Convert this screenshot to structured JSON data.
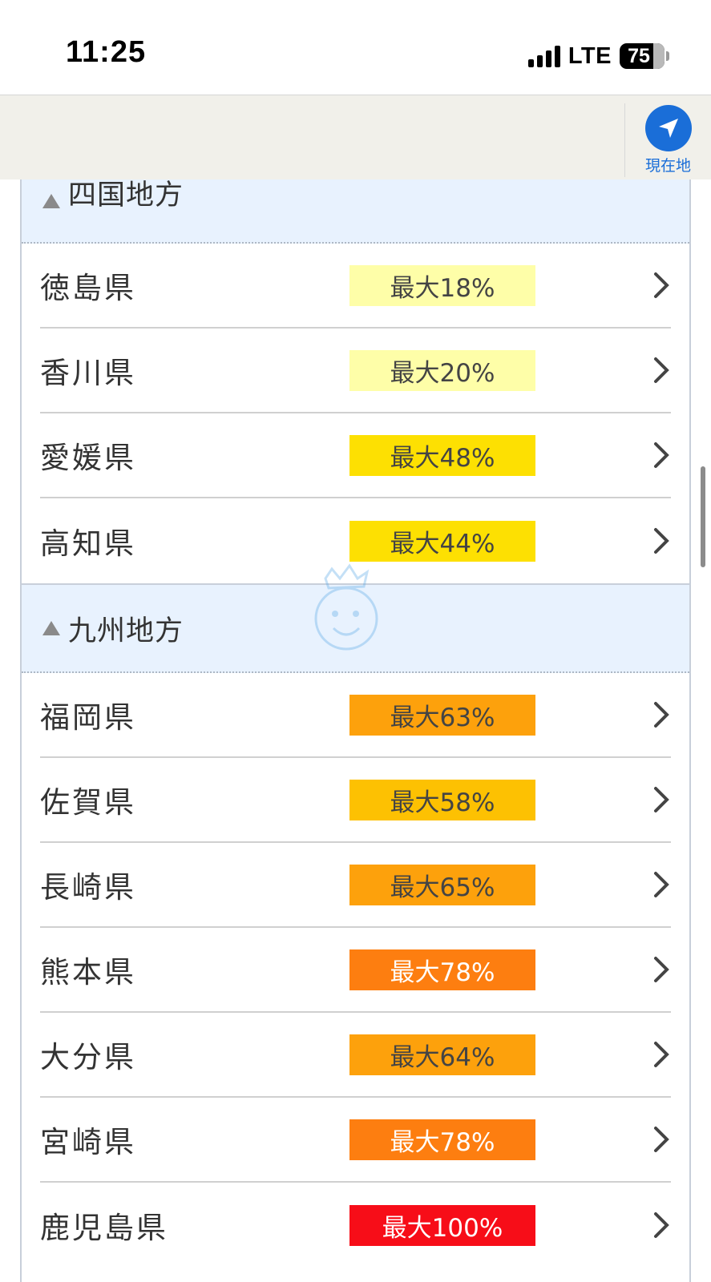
{
  "status_bar": {
    "time": "11:25",
    "network": "LTE",
    "battery": "75"
  },
  "toolbar": {
    "location_label": "現在地",
    "location_icon": "navigation-arrow-icon",
    "accent_color": "#1a6ed8"
  },
  "regions": [
    {
      "title": "四国地方",
      "prefectures": [
        {
          "name": "徳島県",
          "badge": "最大18%",
          "color": "#fefea8"
        },
        {
          "name": "香川県",
          "badge": "最大20%",
          "color": "#fefea8"
        },
        {
          "name": "愛媛県",
          "badge": "最大48%",
          "color": "#fde002"
        },
        {
          "name": "高知県",
          "badge": "最大44%",
          "color": "#fde002"
        }
      ]
    },
    {
      "title": "九州地方",
      "prefectures": [
        {
          "name": "福岡県",
          "badge": "最大63%",
          "color": "#fda10c"
        },
        {
          "name": "佐賀県",
          "badge": "最大58%",
          "color": "#fdc102"
        },
        {
          "name": "長崎県",
          "badge": "最大65%",
          "color": "#fda10c"
        },
        {
          "name": "熊本県",
          "badge": "最大78%",
          "color": "#fd7e10"
        },
        {
          "name": "大分県",
          "badge": "最大64%",
          "color": "#fda10c"
        },
        {
          "name": "宮崎県",
          "badge": "最大78%",
          "color": "#fd7e10"
        },
        {
          "name": "鹿児島県",
          "badge": "最大100%",
          "color": "#f70d18"
        }
      ]
    }
  ]
}
